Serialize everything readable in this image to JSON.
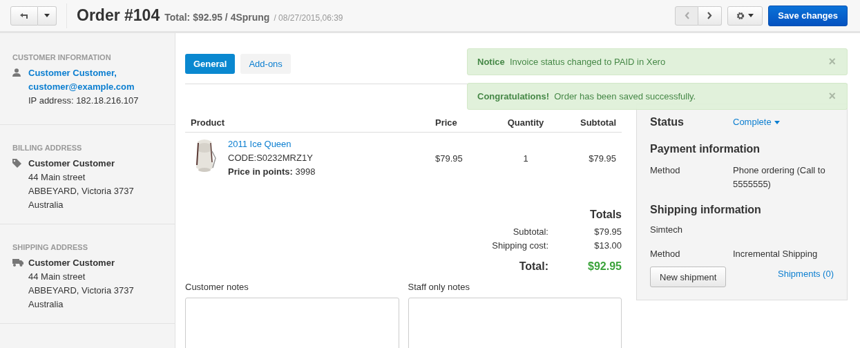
{
  "header": {
    "title": "Order #104",
    "summary": "Total: $92.95 / 4Sprung",
    "date": "/ 08/27/2015,06:39",
    "save_button": "Save changes"
  },
  "sidebar": {
    "sections": [
      {
        "kind": "customer",
        "heading": "CUSTOMER INFORMATION",
        "name": "Customer Customer,",
        "email": "customer@example.com",
        "lines": [
          "IP address: 182.18.216.107"
        ]
      },
      {
        "kind": "billing",
        "heading": "BILLING ADDRESS",
        "name": "Customer Customer",
        "lines": [
          "44 Main street",
          "ABBEYARD, Victoria 3737",
          "Australia"
        ]
      },
      {
        "kind": "shipping",
        "heading": "SHIPPING ADDRESS",
        "name": "Customer Customer",
        "lines": [
          "44 Main street",
          "ABBEYARD, Victoria 3737",
          "Australia"
        ]
      }
    ]
  },
  "tabs": [
    {
      "label": "General",
      "selected": true
    },
    {
      "label": "Add-ons",
      "selected": false
    }
  ],
  "notifications": [
    {
      "title": "Notice",
      "message": "Invoice status changed to PAID in Xero",
      "close": "×"
    },
    {
      "title": "Congratulations!",
      "message": "Order has been saved successfully.",
      "close": "×"
    }
  ],
  "table": {
    "columns": [
      "Product",
      "Price",
      "Quantity",
      "Subtotal"
    ],
    "rows": [
      {
        "name": "2011 Ice Queen",
        "code": "CODE:S0232MRZ1Y",
        "points_label": "Price in points:",
        "points": "3998",
        "price": "$79.95",
        "quantity": "1",
        "subtotal": "$79.95"
      }
    ]
  },
  "totals": {
    "title": "Totals",
    "rows": [
      {
        "label": "Subtotal:",
        "value": "$79.95"
      },
      {
        "label": "Shipping cost:",
        "value": "$13.00"
      }
    ],
    "total_label": "Total:",
    "total_value": "$92.95"
  },
  "notes": [
    {
      "label": "Customer notes"
    },
    {
      "label": "Staff only notes"
    }
  ],
  "panel": {
    "status_label": "Status",
    "status_value": "Complete",
    "payment_title": "Payment information",
    "payment_rows": [
      {
        "label": "Method",
        "value": "Phone ordering (Call to 5555555)"
      }
    ],
    "shipping_title": "Shipping information",
    "carrier": "Simtech",
    "shipping_rows": [
      {
        "label": "Method",
        "value": "Incremental Shipping"
      }
    ],
    "shipment_button": "New shipment",
    "shipments_link": "Shipments (0)"
  }
}
